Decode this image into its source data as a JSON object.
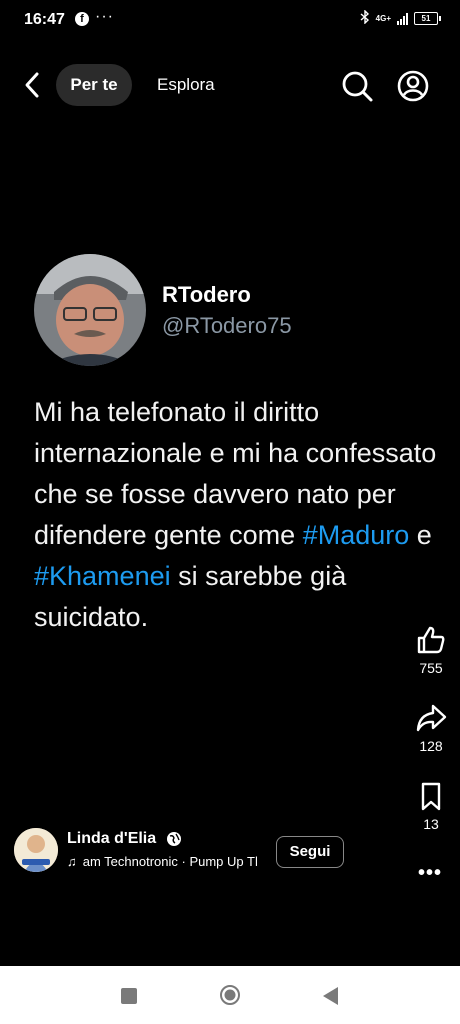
{
  "status_bar": {
    "time": "16:47",
    "dots": "···",
    "network": "4G+",
    "battery": "51"
  },
  "nav": {
    "tabs": [
      "Per te",
      "Esplora"
    ]
  },
  "tweet": {
    "name": "RTodero",
    "handle": "@RTodero75",
    "text_parts": [
      "Mi ha telefonato il diritto internazionale e mi ha confessato che se fosse davvero nato per difendere gente come ",
      "#Maduro",
      " e ",
      "#Khamenei",
      " si sarebbe già suicidato."
    ]
  },
  "actions": {
    "likes": "755",
    "shares": "128",
    "saves": "13"
  },
  "author": {
    "name": "Linda d'Elia",
    "music": "am       Technotronic · Pump Up The Jam",
    "follow_label": "Segui",
    "more": "•••"
  },
  "icons": {
    "back": "back-arrow-icon",
    "search": "search-icon",
    "profile": "profile-icon",
    "like": "thumbs-up-icon",
    "share": "share-arrow-icon",
    "save": "bookmark-icon",
    "globe": "globe-icon",
    "music": "music-note-icon"
  },
  "colors": {
    "background": "#000000",
    "hashtag": "#1d9bf0",
    "handle": "#8b98a5"
  }
}
